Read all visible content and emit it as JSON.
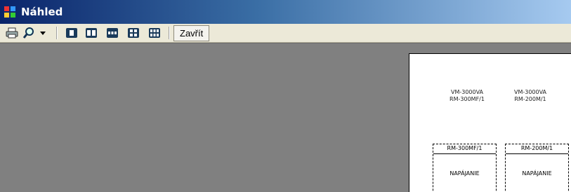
{
  "window": {
    "title": "Náhled"
  },
  "toolbar": {
    "buttons": [
      {
        "icon": "print-icon"
      },
      {
        "icon": "zoom-icon"
      },
      {
        "icon": "dropdown-arrow-icon"
      },
      {
        "icon": "one-page-icon"
      },
      {
        "icon": "two-pages-icon"
      },
      {
        "icon": "three-pages-icon"
      },
      {
        "icon": "four-pages-icon"
      },
      {
        "icon": "six-pages-icon"
      }
    ],
    "close_label": "Zavřít"
  },
  "preview": {
    "labels": [
      {
        "line1": "VM-3000VA",
        "line2": "RM-300MF/1"
      },
      {
        "line1": "VM-3000VA",
        "line2": "RM-200M/1"
      }
    ],
    "boxes": [
      {
        "header": "RM-300MF/1",
        "text": "NAPÁJANIE"
      },
      {
        "header": "RM-200M/1",
        "text": "NAPÁJANIE"
      }
    ]
  }
}
